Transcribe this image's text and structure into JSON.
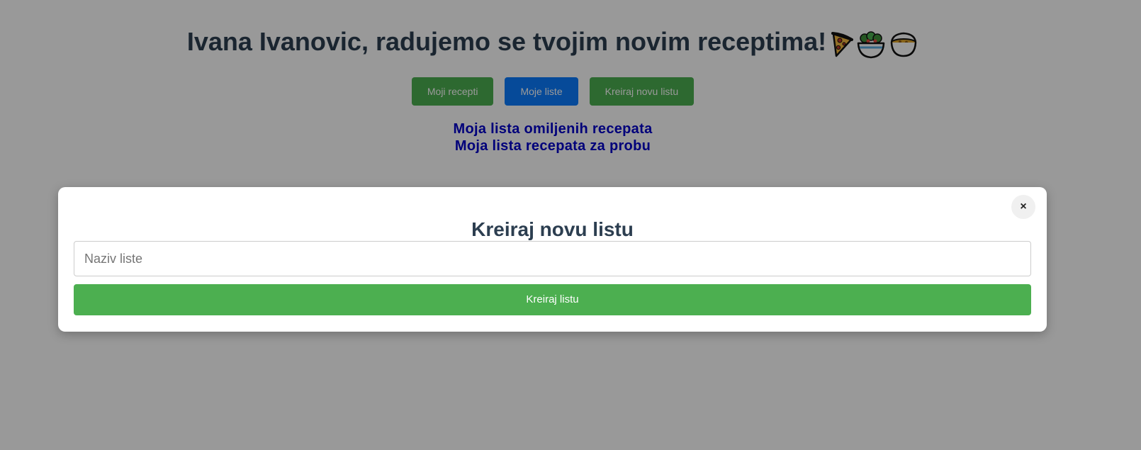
{
  "header": {
    "greeting": "Ivana Ivanovic, radujemo se tvojim novim receptima!"
  },
  "nav": {
    "my_recipes": "Moji recepti",
    "my_lists": "Moje liste",
    "create_list": "Kreiraj novu listu"
  },
  "lists": [
    {
      "label": "Moja lista omiljenih recepata"
    },
    {
      "label": "Moja lista recepata za probu"
    }
  ],
  "modal": {
    "close_label": "×",
    "title": "Kreiraj novu listu",
    "input_placeholder": "Naziv liste",
    "input_value": "",
    "submit_label": "Kreiraj listu"
  },
  "colors": {
    "primary_green": "#4caf50",
    "primary_blue": "#0a7cff",
    "link_blue": "#0000cc",
    "title_dark": "#2c3e50"
  },
  "icons": [
    "pizza-icon",
    "salad-icon",
    "soup-bowl-icon"
  ]
}
